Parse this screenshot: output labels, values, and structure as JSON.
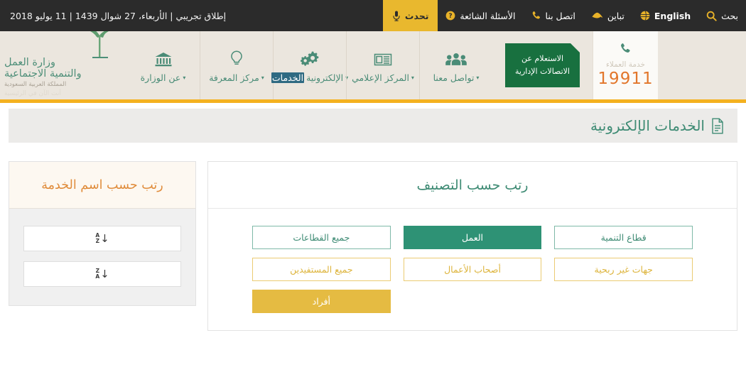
{
  "topbar": {
    "announcement": "إطلاق تجريبي  |  الأربعاء، 27 شوال 1439  |  11 يوليو 2018",
    "items": [
      {
        "label": "تحدث",
        "icon": "microphone-icon",
        "style": "highlight"
      },
      {
        "label": "الأسئلة الشائعة",
        "icon": "question-circle-icon",
        "style": "plain"
      },
      {
        "label": "اتصل بنا",
        "icon": "phone-icon",
        "style": "plain"
      },
      {
        "label": "تباين",
        "icon": "contrast-icon",
        "style": "plain"
      },
      {
        "label": "English",
        "icon": "globe-icon",
        "style": "plain"
      },
      {
        "label": "بحث",
        "icon": "search-icon",
        "style": "plain"
      }
    ],
    "accent_color": "#E9B82E",
    "background_color": "#2B2B2B"
  },
  "brand": {
    "line1": "وزارة العمل",
    "line2": "والتنمية الاجتماعية",
    "line3": "المملكة العربية السعودية",
    "line4": "أنت الآن في الرئيسية",
    "color": "#4E8F79"
  },
  "nav": {
    "items": [
      {
        "label": "عن الوزارة",
        "icon": "bank-icon",
        "caret": "▾",
        "selected": false
      },
      {
        "label": "مركز المعرفة",
        "icon": "lightbulb-icon",
        "caret": "▾",
        "selected": false
      },
      {
        "label": "الخدمات الإلكترونية",
        "icon": "gears-icon",
        "caret": "▾",
        "selected": true,
        "highlight_part": "الخدمات",
        "rest_part": " الإلكترونية"
      },
      {
        "label": "المركز الإعلامي",
        "icon": "newspaper-icon",
        "caret": "▾",
        "selected": false
      },
      {
        "label": "تواصل معنا",
        "icon": "people-icon",
        "caret": "▾",
        "selected": false
      }
    ],
    "green_button": {
      "line1": "الاستعلام عن",
      "line2": "الاتصالات الإدارية",
      "color": "#18703F"
    },
    "customer_care": {
      "icon": "phone-icon",
      "label": "خدمة العملاء",
      "number": "19911",
      "number_color": "#E2762B"
    },
    "background_color": "#EBE6DE",
    "underline_color": "#F4B120"
  },
  "page_title": {
    "text": "الخدمات الإلكترونية",
    "icon": "document-icon",
    "color": "#3E8B74"
  },
  "sort_by_name": {
    "header": "رتب حسب اسم الخدمة",
    "header_color": "#E08C3B",
    "buttons": [
      {
        "name": "sort-a-z",
        "arrow": "↓",
        "top_letter": "A",
        "bottom_letter": "Z"
      },
      {
        "name": "sort-z-a",
        "arrow": "↓",
        "top_letter": "Z",
        "bottom_letter": "A"
      }
    ]
  },
  "sort_by_category": {
    "header": "رتب حسب التصنيف",
    "header_color": "#3E8B74",
    "rows": [
      [
        {
          "label": "قطاع التنمية",
          "style": "teal-out",
          "selected": false
        },
        {
          "label": "العمل",
          "style": "teal-fill",
          "selected": true
        },
        {
          "label": "جميع القطاعات",
          "style": "teal-out",
          "selected": false
        }
      ],
      [
        {
          "label": "جهات غير ربحية",
          "style": "gold-out",
          "selected": false
        },
        {
          "label": "أصحاب الأعمال",
          "style": "gold-out",
          "selected": false
        },
        {
          "label": "جميع المستفيدين",
          "style": "gold-out",
          "selected": false
        }
      ],
      [
        {
          "label": "",
          "style": "empty",
          "selected": false
        },
        {
          "label": "",
          "style": "empty",
          "selected": false
        },
        {
          "label": "أفراد",
          "style": "gold-fill",
          "selected": true
        }
      ]
    ]
  },
  "colors": {
    "teal": "#2E9275",
    "teal_text": "#3E8B74",
    "gold": "#E5BB42",
    "gold_text": "#DDB43C",
    "orange": "#E08C3B",
    "dark_green": "#18703F",
    "selection_highlight": "#2F6A82"
  }
}
